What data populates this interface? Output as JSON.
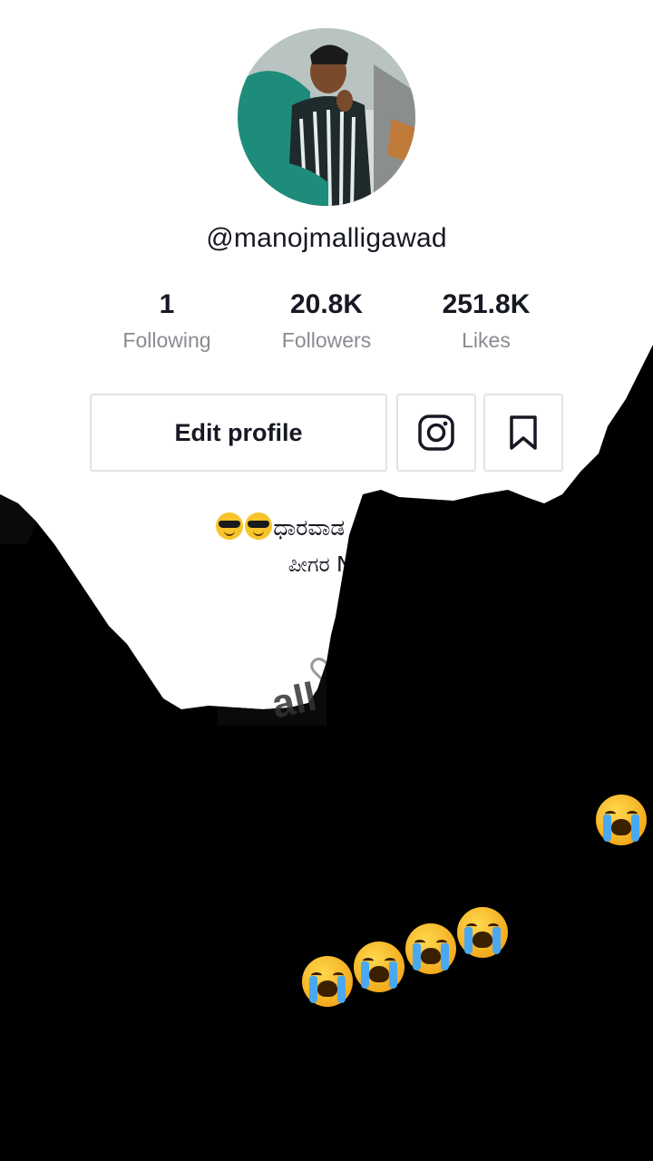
{
  "profile": {
    "username": "@manojmalligawad",
    "stats": [
      {
        "value": "1",
        "label": "Following"
      },
      {
        "value": "20.8K",
        "label": "Followers"
      },
      {
        "value": "251.8K",
        "label": "Likes"
      }
    ],
    "edit_profile_label": "Edit profile",
    "bio_line1_text": "ಧಾರವಾಡ ಹುಡುಗ",
    "bio_line2_text": "ಪೀಗರ Ne"
  },
  "overlay": {
    "watermark_text": "all"
  },
  "icons": {
    "instagram": "instagram-icon",
    "bookmark": "bookmark-icon",
    "liked": "heart-outline-icon",
    "emoji_cool": "sunglasses-emoji-icon",
    "emoji_cry": "loudly-crying-emoji-icon"
  },
  "colors": {
    "text_primary": "#161823",
    "text_secondary": "#8a8b91",
    "border": "#e3e3e4",
    "overlay_dark": "#000000"
  }
}
